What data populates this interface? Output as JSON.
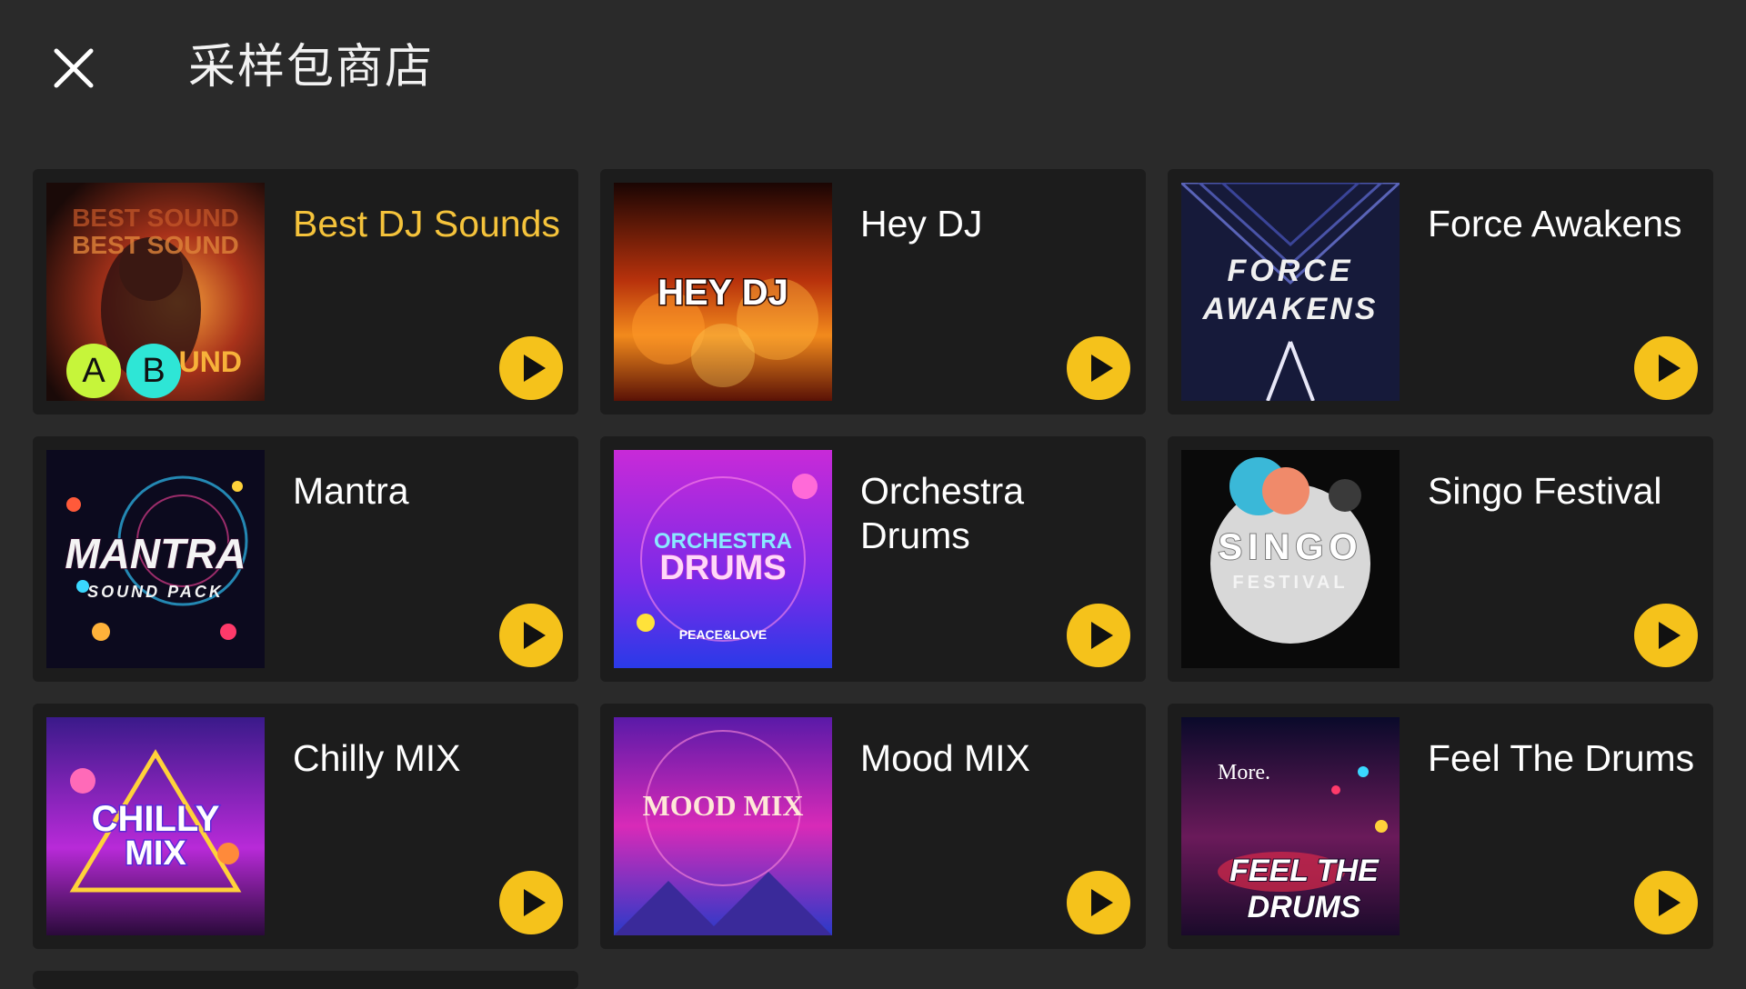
{
  "header": {
    "close_icon": "close-icon",
    "title": "采样包商店"
  },
  "colors": {
    "background": "#2a2a2a",
    "card": "#1c1c1c",
    "accent": "#f5c21b",
    "active_title": "#f5c33b"
  },
  "packs": [
    {
      "title": "Best DJ Sounds",
      "cover_text": "BEST SOUND",
      "active": true,
      "badges": [
        "A",
        "B"
      ]
    },
    {
      "title": "Hey DJ",
      "cover_text": "HEY DJ"
    },
    {
      "title": "Force Awakens",
      "cover_text": "FORCE AWAKENS"
    },
    {
      "title": "Mantra",
      "cover_text": "MANTRA",
      "cover_subtext": "SOUND PACK"
    },
    {
      "title": "Orchestra Drums",
      "cover_text": "ORCHESTRA",
      "cover_subtext": "DRUMS",
      "cover_footer": "PEACE&LOVE"
    },
    {
      "title": "Singo Festival",
      "cover_text": "SINGO",
      "cover_subtext": "FESTIVAL"
    },
    {
      "title": "Chilly MIX",
      "cover_text": "CHILLY",
      "cover_subtext": "MIX"
    },
    {
      "title": "Mood MIX",
      "cover_text": "MOOD MIX"
    },
    {
      "title": "Feel The Drums",
      "cover_text": "FEEL THE",
      "cover_subtext": "DRUMS",
      "cover_script": "More."
    }
  ]
}
